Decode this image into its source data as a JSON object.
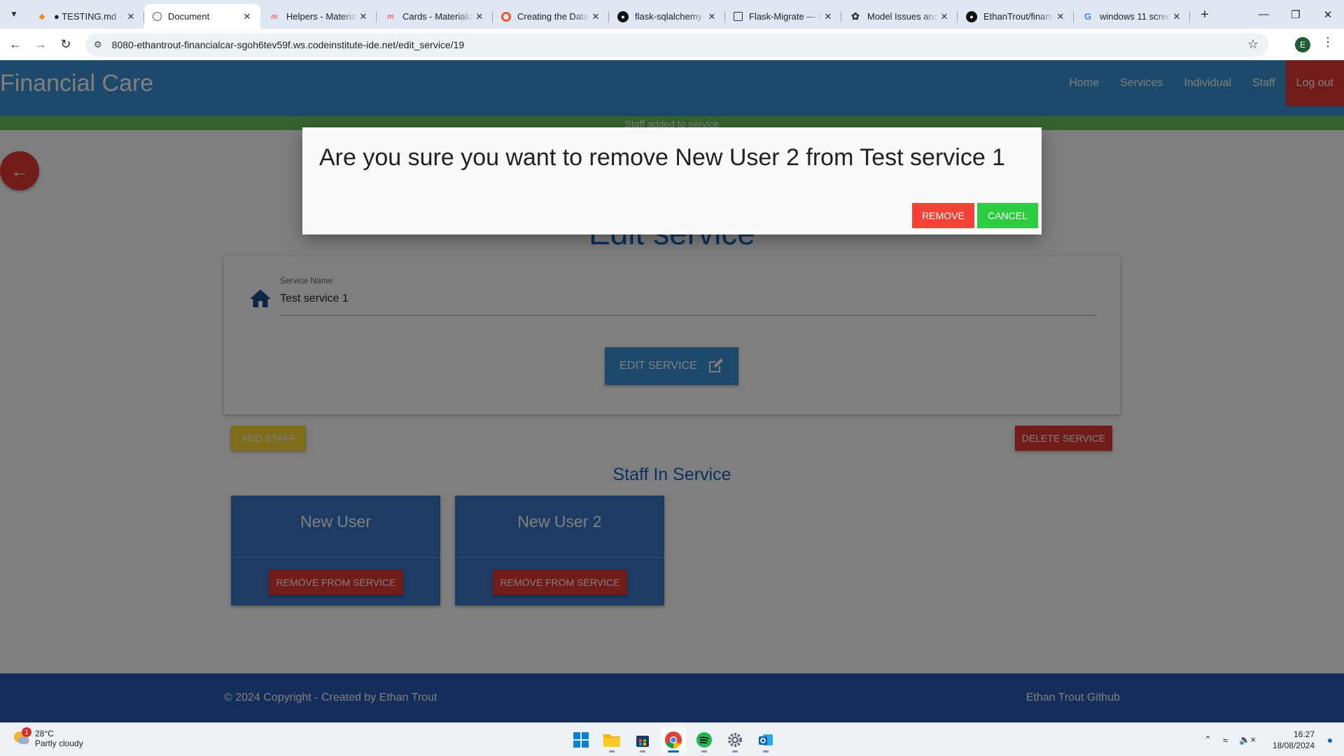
{
  "browser": {
    "tabs": [
      {
        "title": "● TESTING.md - fi",
        "favicon": "gitpod-icon",
        "active": false
      },
      {
        "title": "Document",
        "favicon": "globe-icon",
        "active": true
      },
      {
        "title": "Helpers - Material",
        "favicon": "materialize-icon",
        "active": false
      },
      {
        "title": "Cards - Materializ",
        "favicon": "materialize-icon",
        "active": false
      },
      {
        "title": "Creating the Data",
        "favicon": "ring-icon",
        "active": false
      },
      {
        "title": "flask-sqlalchemy-",
        "favicon": "github-icon",
        "active": false
      },
      {
        "title": "Flask-Migrate — F",
        "favicon": "docs-icon",
        "active": false
      },
      {
        "title": "Model Issues and",
        "favicon": "openai-icon",
        "active": false
      },
      {
        "title": "EthanTrout/financ",
        "favicon": "github-icon",
        "active": false
      },
      {
        "title": "windows 11 scree",
        "favicon": "google-icon",
        "active": false
      }
    ],
    "url": "8080-ethantrout-financialcar-sgoh6tev59f.ws.codeinstitute-ide.net/edit_service/19",
    "profile_initial": "E"
  },
  "site": {
    "brand": "Financial Care",
    "nav": [
      "Home",
      "Services",
      "Individual",
      "Staff",
      "Log out"
    ],
    "flash": "Staff added to service",
    "page_title": "Edit service",
    "form": {
      "label": "Service Name",
      "value": "Test service 1",
      "edit_button": "EDIT SERVICE"
    },
    "add_staff_button": "ADD STAFF",
    "delete_service_button": "DELETE SERVICE",
    "staff_section_title": "Staff In Service",
    "staff": [
      {
        "name": "New User",
        "button": "REMOVE FROM SERVICE"
      },
      {
        "name": "New User 2",
        "button": "REMOVE FROM SERVICE"
      }
    ],
    "footer": {
      "copyright": "© 2024 Copyright - Created by Ethan Trout",
      "link": "Ethan Trout Github"
    }
  },
  "modal": {
    "message": "Are you sure you want to remove New User 2 from Test service 1",
    "remove_button": "REMOVE",
    "cancel_button": "CANCEL"
  },
  "taskbar": {
    "weather_temp": "28°C",
    "weather_desc": "Partly cloudy",
    "weather_badge": "1",
    "time": "16:27",
    "date": "18/08/2024"
  },
  "colors": {
    "navbar": "#3b94d6",
    "danger": "#e53935",
    "success": "#2ecc40",
    "footer": "#2b5bb5",
    "heading": "#1565c0"
  }
}
